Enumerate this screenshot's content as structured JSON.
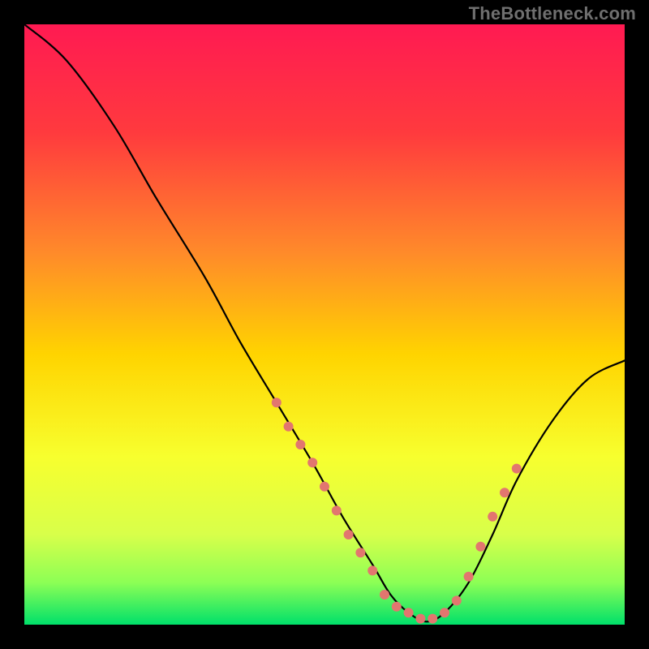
{
  "watermark": "TheBottleneck.com",
  "chart_data": {
    "type": "line",
    "title": "",
    "xlabel": "",
    "ylabel": "",
    "xlim": [
      0,
      100
    ],
    "ylim": [
      0,
      100
    ],
    "background_gradient": {
      "top": "#ff1a52",
      "mid_upper": "#ff6a2a",
      "mid": "#ffd400",
      "mid_lower": "#f7ff2e",
      "lower": "#b8ff4a",
      "bottom": "#00e06a"
    },
    "series": [
      {
        "name": "bottleneck-curve",
        "color": "#000000",
        "x": [
          0,
          7,
          15,
          22,
          30,
          36,
          42,
          48,
          53,
          58,
          61,
          64,
          67,
          70,
          74,
          78,
          82,
          88,
          94,
          100
        ],
        "y": [
          100,
          94,
          83,
          71,
          58,
          47,
          37,
          27,
          18,
          10,
          5,
          2,
          0.5,
          2,
          7,
          15,
          24,
          34,
          41,
          44
        ]
      }
    ],
    "markers": {
      "name": "highlight-dots",
      "color": "#e2766f",
      "radius_px": 6,
      "points": [
        {
          "x": 42,
          "y": 37
        },
        {
          "x": 44,
          "y": 33
        },
        {
          "x": 46,
          "y": 30
        },
        {
          "x": 48,
          "y": 27
        },
        {
          "x": 50,
          "y": 23
        },
        {
          "x": 52,
          "y": 19
        },
        {
          "x": 54,
          "y": 15
        },
        {
          "x": 56,
          "y": 12
        },
        {
          "x": 58,
          "y": 9
        },
        {
          "x": 60,
          "y": 5
        },
        {
          "x": 62,
          "y": 3
        },
        {
          "x": 64,
          "y": 2
        },
        {
          "x": 66,
          "y": 1
        },
        {
          "x": 68,
          "y": 1
        },
        {
          "x": 70,
          "y": 2
        },
        {
          "x": 72,
          "y": 4
        },
        {
          "x": 74,
          "y": 8
        },
        {
          "x": 76,
          "y": 13
        },
        {
          "x": 78,
          "y": 18
        },
        {
          "x": 80,
          "y": 22
        },
        {
          "x": 82,
          "y": 26
        }
      ]
    }
  }
}
